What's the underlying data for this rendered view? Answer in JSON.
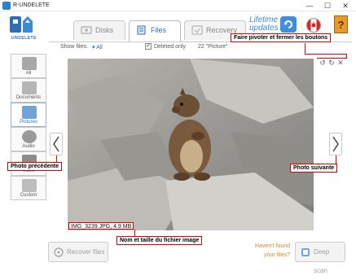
{
  "window": {
    "title": "R-UNDELETE",
    "minimize": "—",
    "maximize": "☐",
    "close": "✕"
  },
  "header": {
    "logo_text": "UNDELETE",
    "tabs": [
      {
        "label": "Disks"
      },
      {
        "label": "Files"
      },
      {
        "label": "Recovery"
      }
    ],
    "updates_line1": "Lifetime",
    "updates_line2": "updates",
    "help_label": "?"
  },
  "filter": {
    "show_label": "Show files:",
    "show_value": "▾ All",
    "deleted_check": "✓",
    "deleted_label": "Deleted only",
    "count_label": "22 \"Picture\""
  },
  "sidebar": {
    "items": [
      {
        "label": "All"
      },
      {
        "label": "Documents"
      },
      {
        "label": "Pictures"
      },
      {
        "label": "Audio"
      },
      {
        "label": "Video"
      },
      {
        "label": "Custom"
      }
    ]
  },
  "viewer": {
    "file_info": "IMG_3239.JPG, 4.9 MB",
    "prev_glyph": "‹",
    "next_glyph": "›",
    "rotate_left": "↺",
    "rotate_right": "↻",
    "close_glyph": "✕"
  },
  "callouts": {
    "rotate_close": "Faire pivoter et fermer les boutons",
    "prev_photo": "Photo précédente",
    "next_photo": "Photo suivante",
    "file_name_size": "Nom et taille du fichier image"
  },
  "footer": {
    "recover_button": "Recover files",
    "haven_line1": "Haven't found",
    "haven_line2": "your files?",
    "deep_scan_button": "Deep scan"
  },
  "colors": {
    "accent": "#2f6db5",
    "callout_red": "#dd0000",
    "orange_text": "#d3862b"
  }
}
